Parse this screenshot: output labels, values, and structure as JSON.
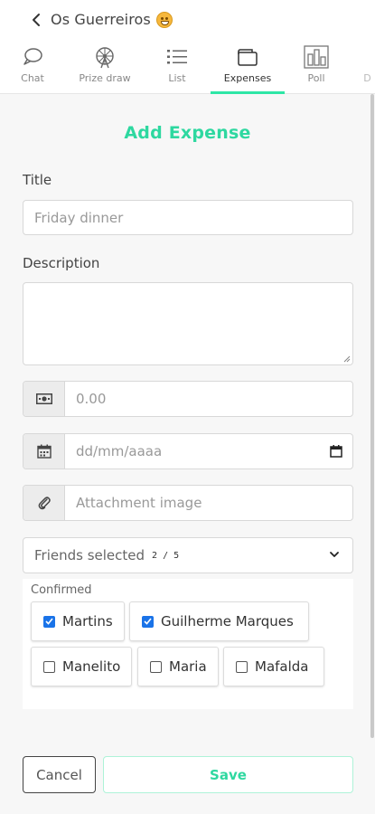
{
  "header": {
    "title": "Os Guerreiros"
  },
  "tabs": [
    {
      "label": "Chat"
    },
    {
      "label": "Prize draw"
    },
    {
      "label": "List"
    },
    {
      "label": "Expenses",
      "active": true
    },
    {
      "label": "Poll"
    },
    {
      "label": "D"
    }
  ],
  "form": {
    "heading": "Add Expense",
    "title_label": "Title",
    "title_placeholder": "Friday dinner",
    "description_label": "Description",
    "amount_placeholder": "0.00",
    "date_placeholder": "dd/mm/aaaa",
    "attachment_placeholder": "Attachment image",
    "friends_select_label": "Friends selected",
    "friends_count": "2 / 5",
    "confirmed_label": "Confirmed",
    "friends": [
      {
        "name": "Martins",
        "checked": true
      },
      {
        "name": "Guilherme Marques",
        "checked": true
      },
      {
        "name": "Manelito",
        "checked": false
      },
      {
        "name": "Maria",
        "checked": false
      },
      {
        "name": "Mafalda",
        "checked": false
      }
    ]
  },
  "actions": {
    "cancel": "Cancel",
    "save": "Save"
  },
  "colors": {
    "accent": "#2ed8a0",
    "checkbox": "#1a73e8"
  }
}
